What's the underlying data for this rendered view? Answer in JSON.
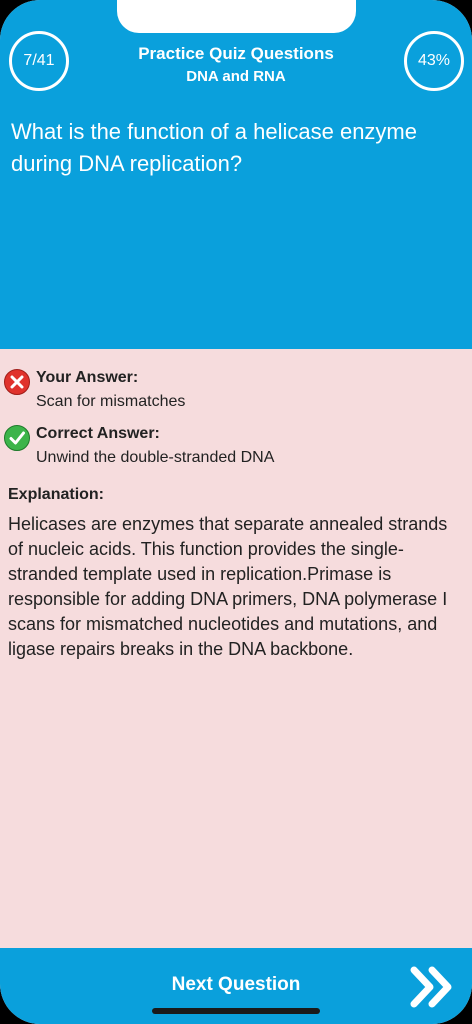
{
  "header": {
    "progress_count": "7/41",
    "title": "Practice Quiz Questions",
    "subtitle": "DNA and RNA",
    "score_percent": "43%"
  },
  "question": {
    "text": "What is the function of a helicase enzyme during DNA replication?"
  },
  "your_answer": {
    "label": "Your Answer:",
    "value": "Scan for mismatches",
    "icon": "wrong-x-icon"
  },
  "correct_answer": {
    "label": "Correct Answer:",
    "value": "Unwind the double-stranded DNA",
    "icon": "check-icon"
  },
  "explanation": {
    "label": "Explanation:",
    "text": "Helicases are enzymes that separate annealed strands of nucleic acids. This function provides the single-stranded template used in replication.Primase is responsible for adding DNA primers, DNA polymerase I scans for mismatched nucleotides and mutations, and ligase repairs breaks in the DNA backbone."
  },
  "footer": {
    "next_label": "Next Question",
    "next_icon": "double-chevron-right-icon"
  },
  "colors": {
    "accent_blue": "#0aa0dc",
    "answer_bg": "#f6dcdd",
    "wrong_red": "#e0322c",
    "correct_green": "#3cb44a"
  }
}
